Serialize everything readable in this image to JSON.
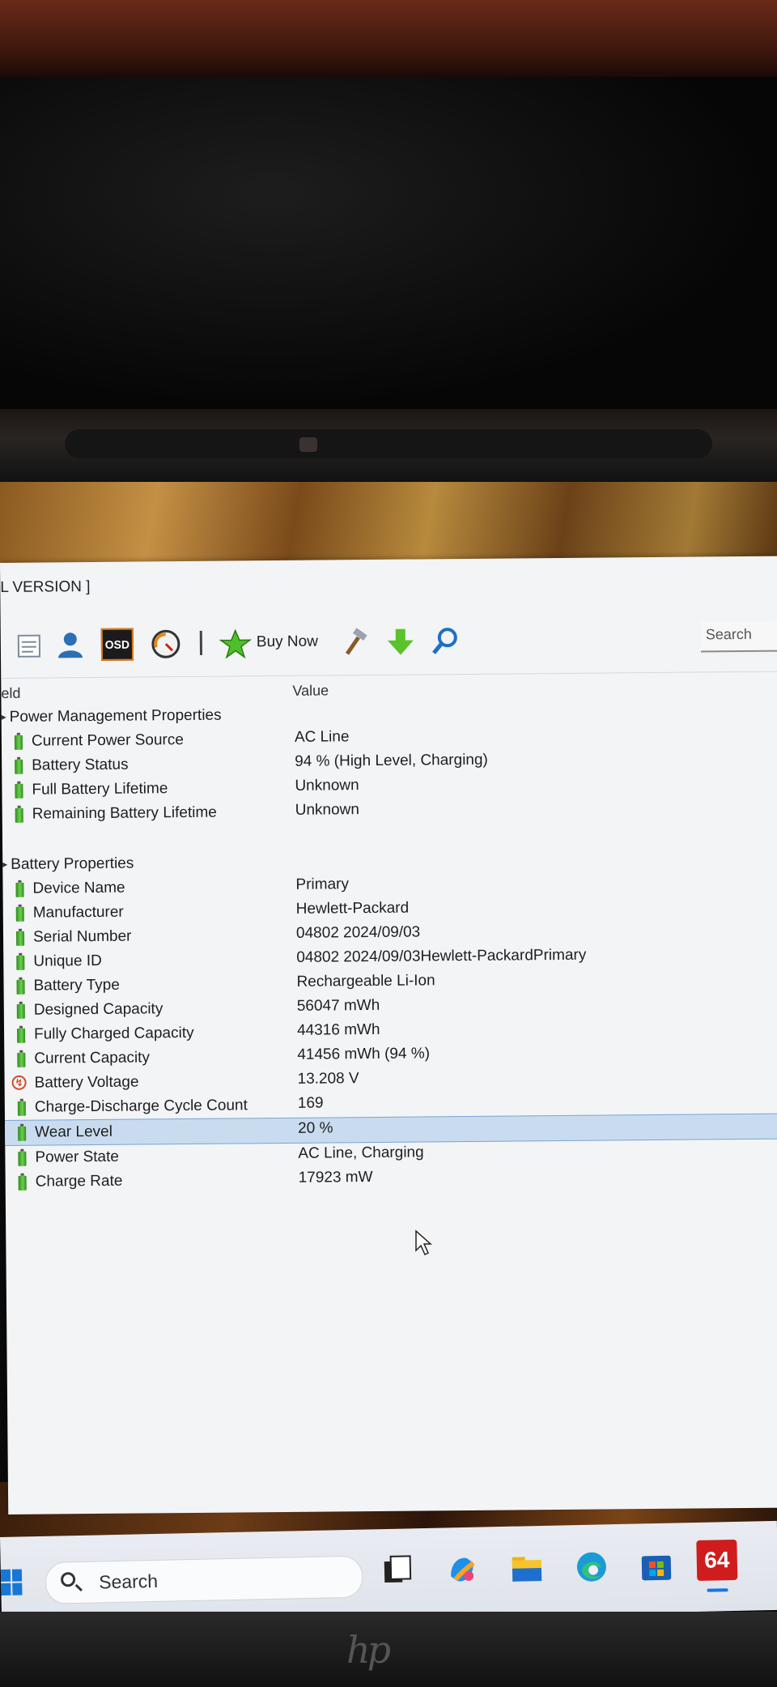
{
  "window": {
    "title": "L VERSION ]"
  },
  "toolbar": {
    "buy_now_label": "Buy Now",
    "search_placeholder": "Search",
    "icons": [
      "report-icon",
      "user-icon",
      "osd-icon",
      "benchmark-gauge-icon",
      "buy-now-icon",
      "tools-icon",
      "download-icon",
      "search-icon"
    ],
    "osd_label": "OSD"
  },
  "columns": {
    "field": "eld",
    "value": "Value"
  },
  "groups": [
    {
      "title": "Power Management Properties",
      "rows": [
        {
          "label": "Current Power Source",
          "value": "AC Line"
        },
        {
          "label": "Battery Status",
          "value": "94 % (High Level, Charging)"
        },
        {
          "label": "Full Battery Lifetime",
          "value": "Unknown"
        },
        {
          "label": "Remaining Battery Lifetime",
          "value": "Unknown"
        }
      ]
    },
    {
      "title": "Battery Properties",
      "rows": [
        {
          "label": "Device Name",
          "value": "Primary"
        },
        {
          "label": "Manufacturer",
          "value": "Hewlett-Packard"
        },
        {
          "label": "Serial Number",
          "value": "04802 2024/09/03"
        },
        {
          "label": "Unique ID",
          "value": "04802 2024/09/03Hewlett-PackardPrimary"
        },
        {
          "label": "Battery Type",
          "value": "Rechargeable Li-Ion"
        },
        {
          "label": "Designed Capacity",
          "value": "56047 mWh"
        },
        {
          "label": "Fully Charged Capacity",
          "value": "44316 mWh"
        },
        {
          "label": "Current Capacity",
          "value": "41456 mWh  (94 %)"
        },
        {
          "label": "Battery Voltage",
          "value": "13.208 V"
        },
        {
          "label": "Charge-Discharge Cycle Count",
          "value": "169"
        },
        {
          "label": "Wear Level",
          "value": "20 %"
        },
        {
          "label": "Power State",
          "value": "AC Line, Charging"
        },
        {
          "label": "Charge Rate",
          "value": "17923 mW"
        }
      ]
    }
  ],
  "selected_row": "Wear Level",
  "taskbar": {
    "search_label": "Search",
    "pinned_badge": "64",
    "icons": [
      "windows-start-icon",
      "search-icon",
      "task-view-icon",
      "copilot-icon",
      "file-explorer-icon",
      "edge-icon",
      "microsoft-store-icon",
      "aida64-icon"
    ]
  },
  "colors": {
    "selection": "#c9dcef",
    "battery_green": "#4caf32",
    "start_blue": "#1877d4",
    "aida_red": "#d01c1c"
  }
}
